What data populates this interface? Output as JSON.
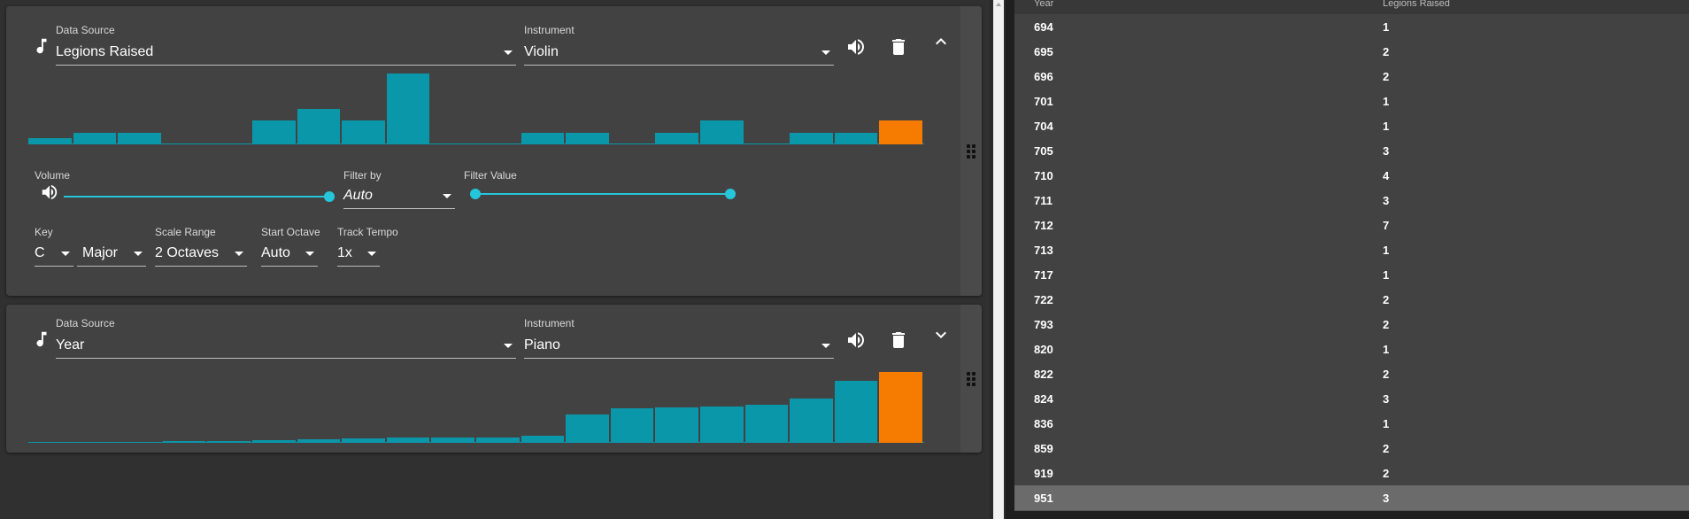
{
  "tracks": [
    {
      "data_source_label": "Data Source",
      "data_source_value": "Legions Raised",
      "instrument_label": "Instrument",
      "instrument_value": "Violin",
      "expanded": true,
      "histogram": [
        1,
        2,
        2,
        0,
        0,
        4,
        6,
        4,
        12,
        0,
        0,
        2,
        2,
        0,
        2,
        4,
        0,
        2,
        2,
        4
      ],
      "histogram_max": 12,
      "volume_label": "Volume",
      "volume_level": 1.0,
      "filter_by_label": "Filter by",
      "filter_by_value": "Auto",
      "filter_value_label": "Filter Value",
      "filter_value_range": [
        0.0,
        1.0
      ],
      "key_label": "Key",
      "key_value": "C",
      "mode_value": "Major",
      "scale_range_label": "Scale Range",
      "scale_range_value": "2 Octaves",
      "start_octave_label": "Start Octave",
      "start_octave_value": "Auto",
      "track_tempo_label": "Track Tempo",
      "track_tempo_value": "1x"
    },
    {
      "data_source_label": "Data Source",
      "data_source_value": "Year",
      "instrument_label": "Instrument",
      "instrument_value": "Piano",
      "expanded": false,
      "histogram": [
        1,
        1,
        1,
        2,
        3,
        4,
        5,
        6,
        7,
        7,
        8,
        10,
        40,
        49,
        50,
        51,
        54,
        63,
        88,
        100
      ],
      "histogram_max": 100
    }
  ],
  "table": {
    "headers": [
      "Year",
      "Legions Raised"
    ],
    "rows": [
      [
        "694",
        "1"
      ],
      [
        "695",
        "2"
      ],
      [
        "696",
        "2"
      ],
      [
        "701",
        "1"
      ],
      [
        "704",
        "1"
      ],
      [
        "705",
        "3"
      ],
      [
        "710",
        "4"
      ],
      [
        "711",
        "3"
      ],
      [
        "712",
        "7"
      ],
      [
        "713",
        "1"
      ],
      [
        "717",
        "1"
      ],
      [
        "722",
        "2"
      ],
      [
        "793",
        "2"
      ],
      [
        "820",
        "1"
      ],
      [
        "822",
        "2"
      ],
      [
        "824",
        "3"
      ],
      [
        "836",
        "1"
      ],
      [
        "859",
        "2"
      ],
      [
        "919",
        "2"
      ],
      [
        "951",
        "3"
      ]
    ],
    "selected_row": 19
  },
  "colors": {
    "bar": "#0b97aa",
    "bar_highlight": "#f57c00",
    "slider": "#26c6da",
    "card": "#424242"
  }
}
